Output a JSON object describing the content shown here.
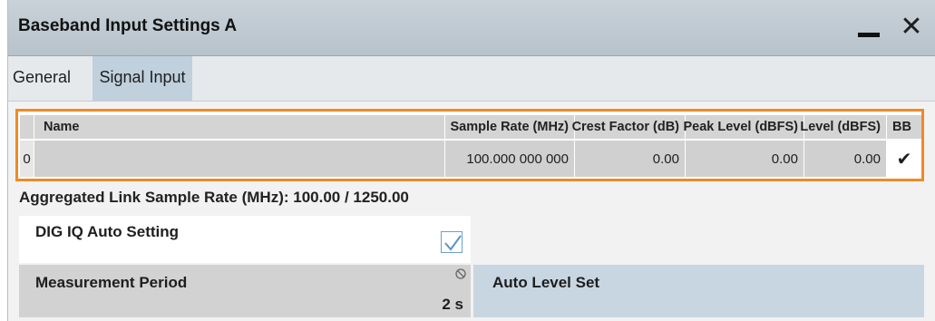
{
  "window": {
    "title": "Baseband Input Settings  A",
    "minimize_icon": "minimize-icon",
    "close_label": "✕"
  },
  "tabs": [
    {
      "label": "General",
      "active": false
    },
    {
      "label": "Signal Input",
      "active": true
    }
  ],
  "table": {
    "columns": [
      "Name",
      "Sample Rate (MHz)",
      "Crest Factor (dB)",
      "Peak Level (dBFS)",
      "Level (dBFS)",
      "BB"
    ],
    "rows": [
      {
        "index": "0",
        "name": "",
        "sample_rate": "100.000 000 000",
        "crest_factor": "0.00",
        "peak_level": "0.00",
        "level": "0.00",
        "bb": "✔"
      }
    ]
  },
  "aggregated_rate": "Aggregated Link Sample Rate (MHz): 100.00 / 1250.00",
  "auto_setting": {
    "label": "DIG IQ Auto Setting",
    "checked": true
  },
  "measurement_period": {
    "label": "Measurement Period",
    "value": "2 s",
    "icon": "disabled-icon"
  },
  "auto_level_set": {
    "label": "Auto Level Set"
  },
  "colors": {
    "accent_outline": "#ef8a26",
    "active_tab": "#c0d0dd",
    "title_bar": "#bcc6ce"
  }
}
